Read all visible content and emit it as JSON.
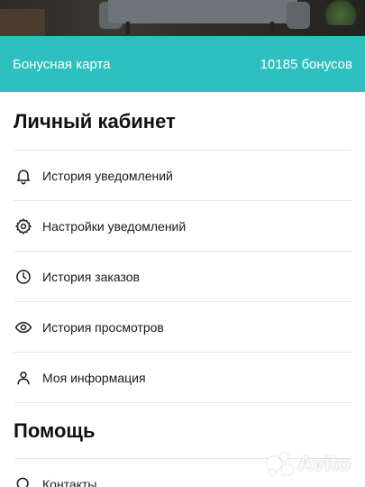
{
  "bonus": {
    "label": "Бонусная карта",
    "value": "10185 бонусов",
    "color": "#2ebfbf"
  },
  "cabinet": {
    "title": "Личный кабинет",
    "items": [
      {
        "label": "История уведомлений",
        "icon": "bell-icon"
      },
      {
        "label": "Настройки уведомлений",
        "icon": "gear-icon"
      },
      {
        "label": "История заказов",
        "icon": "clock-icon"
      },
      {
        "label": "История просмотров",
        "icon": "eye-icon"
      },
      {
        "label": "Моя информация",
        "icon": "user-icon"
      }
    ]
  },
  "help": {
    "title": "Помощь",
    "items": [
      {
        "label": "Контакты",
        "icon": "search-icon"
      }
    ]
  },
  "watermark": {
    "text": "Avito"
  }
}
